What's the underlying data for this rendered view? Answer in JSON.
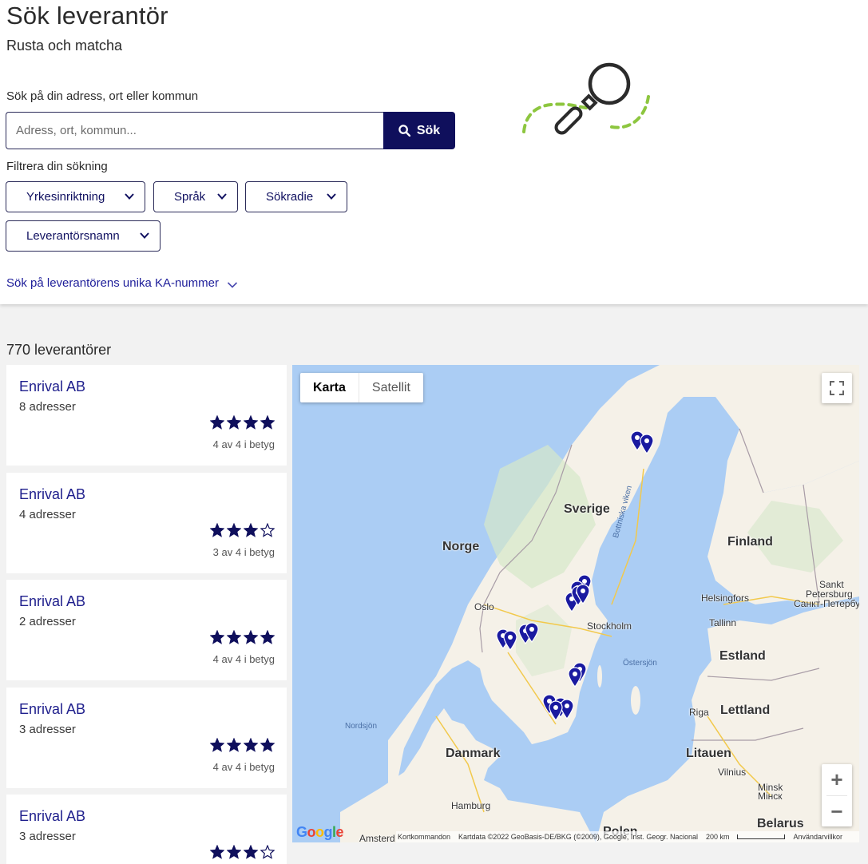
{
  "header": {
    "title": "Sök leverantör",
    "subtitle": "Rusta och matcha"
  },
  "search": {
    "label": "Sök på din adress, ort eller kommun",
    "placeholder": "Adress, ort, kommun...",
    "value": "",
    "button_label": "Sök"
  },
  "filters": {
    "label": "Filtrera din sökning",
    "items": [
      {
        "label": "Yrkesinriktning"
      },
      {
        "label": "Språk"
      },
      {
        "label": "Sökradie"
      },
      {
        "label": "Leverantörsnamn"
      }
    ]
  },
  "ka_link": "Sök på leverantörens unika KA-nummer",
  "results": {
    "count_label": "770 leverantörer",
    "cards": [
      {
        "name": "Enrival AB",
        "addresses": "8 adresser",
        "rating": 4,
        "rating_max": 4,
        "rating_text": "4 av 4 i betyg"
      },
      {
        "name": "Enrival AB",
        "addresses": "4 adresser",
        "rating": 3,
        "rating_max": 4,
        "rating_text": "3 av 4 i betyg"
      },
      {
        "name": "Enrival AB",
        "addresses": "2 adresser",
        "rating": 4,
        "rating_max": 4,
        "rating_text": "4 av 4 i betyg"
      },
      {
        "name": "Enrival AB",
        "addresses": "3 adresser",
        "rating": 4,
        "rating_max": 4,
        "rating_text": "4 av 4 i betyg"
      },
      {
        "name": "Enrival AB",
        "addresses": "3 adresser",
        "rating": 3,
        "rating_max": 4,
        "rating_text": ""
      }
    ]
  },
  "map": {
    "type_options": [
      "Karta",
      "Satellit"
    ],
    "active_type": "Karta",
    "labels": {
      "sverige": "Sverige",
      "norge": "Norge",
      "finland": "Finland",
      "estland": "Estland",
      "lettland": "Lettland",
      "litauen": "Litauen",
      "danmark": "Danmark",
      "belarus": "Belarus",
      "polen": "Polen",
      "oslo": "Oslo",
      "stockholm": "Stockholm",
      "helsingfors": "Helsingfors",
      "sankt_petersburg_1": "Sankt",
      "sankt_petersburg_2": "Petersburg",
      "sankt_petersburg_ru": "Санкт-Петербург",
      "tallinn": "Tallinn",
      "riga": "Riga",
      "vilnius_1": "Vilnius",
      "vilnius_2": "Vilnius",
      "minsk_1": "Minsk",
      "minsk_2": "Мінск",
      "hamburg": "Hamburg",
      "amsterdam": "Amsterd",
      "ostersjon": "Östersjön",
      "nordsjon": "Nordsjön",
      "bottniska_viken": "Bottniska viken"
    },
    "google": "Google",
    "attribution": {
      "shortcuts": "Kortkommandon",
      "mapdata": "Kartdata ©2022 GeoBasis-DE/BKG (©2009), Google, Inst. Geogr. Nacional",
      "scale": "200 km",
      "terms": "Användarvillkor"
    },
    "pin_color": "#1a1aa0"
  },
  "colors": {
    "primary": "#0f0f5c",
    "link": "#1e1e9a",
    "illustration_green": "#8dc63f"
  }
}
